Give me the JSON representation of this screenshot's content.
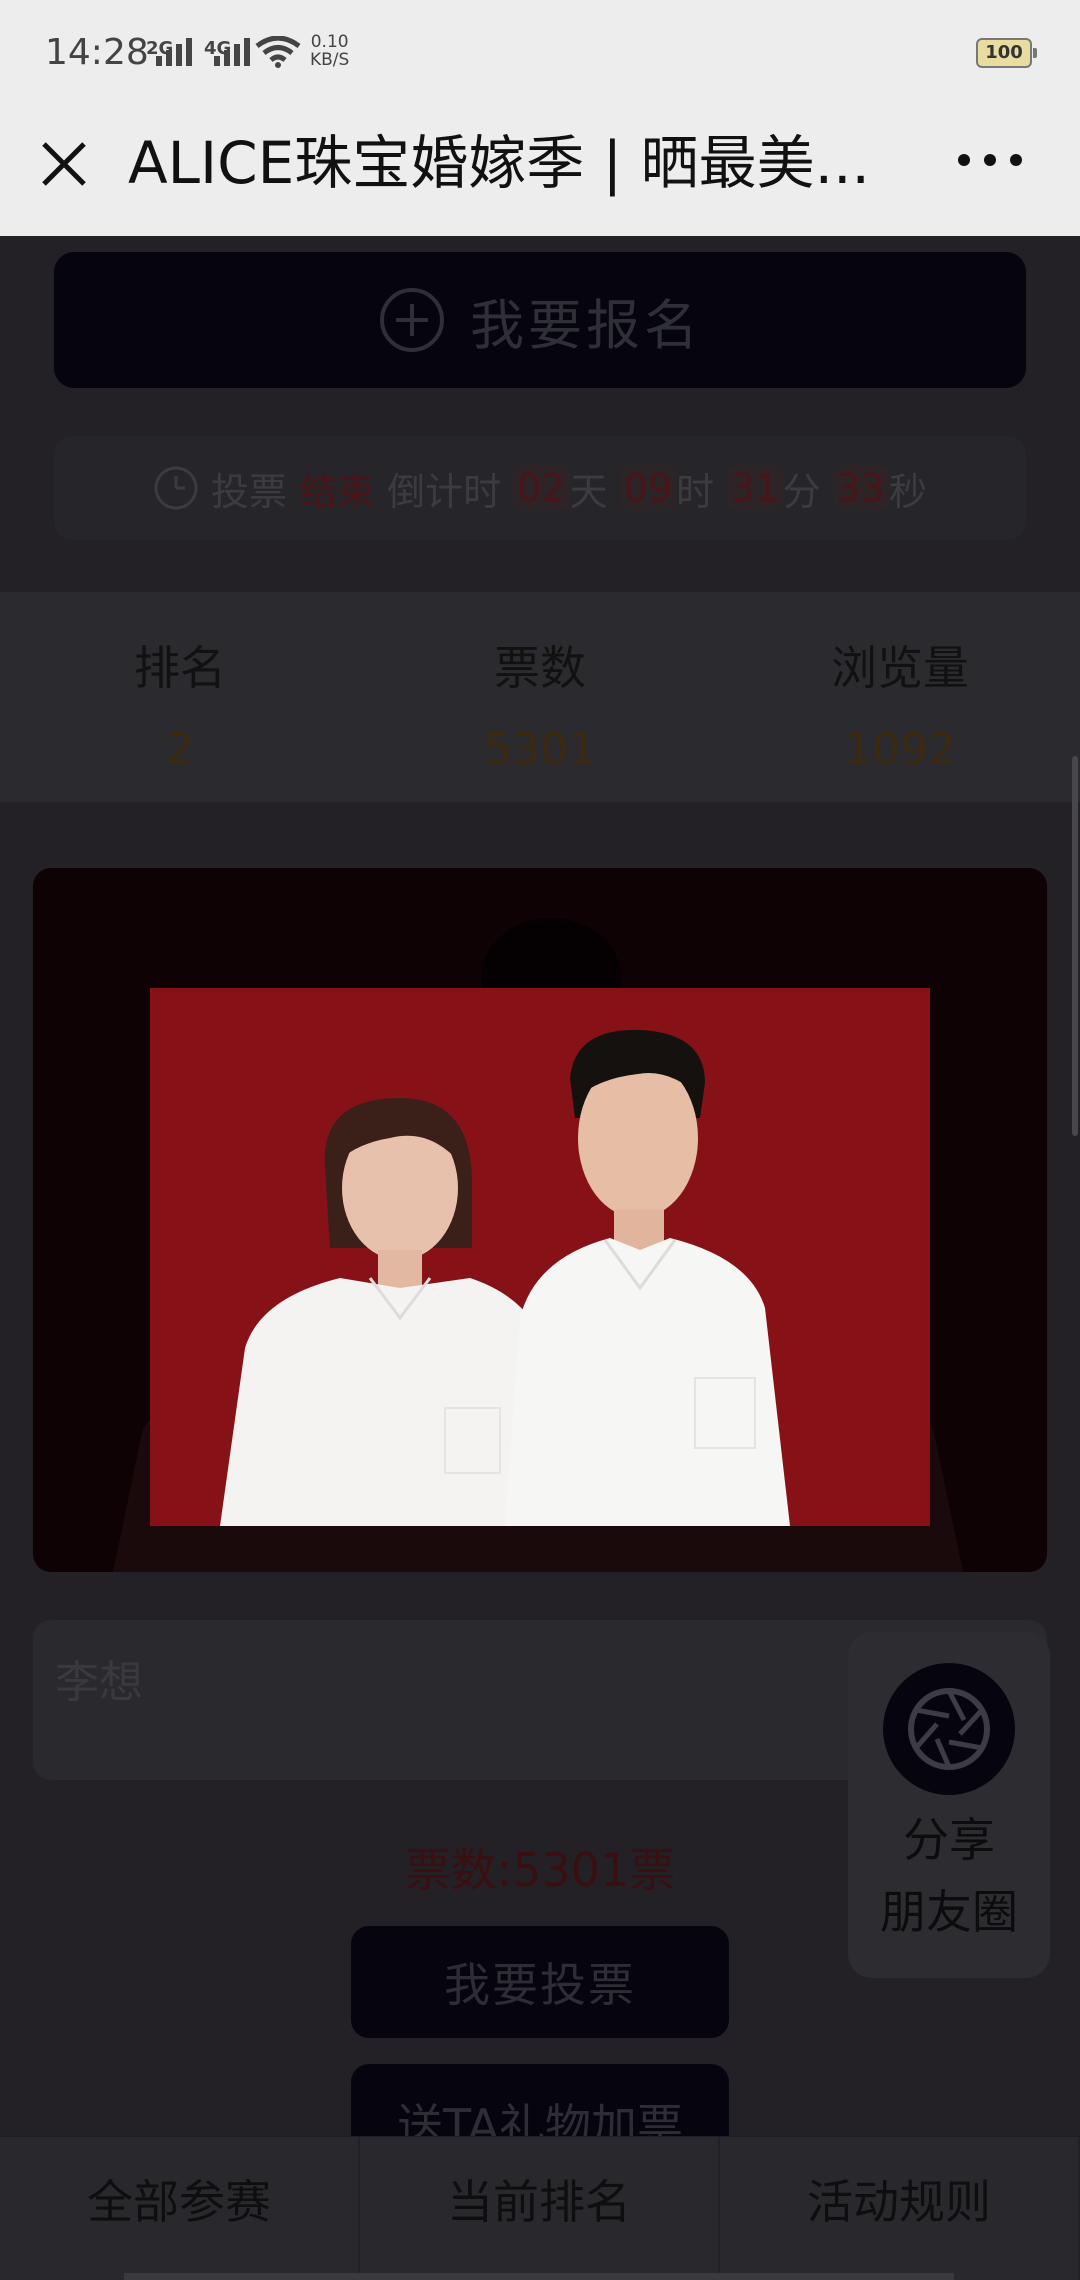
{
  "status_bar": {
    "time": "14:28",
    "sig1": "2G",
    "sig2": "4G",
    "speed_value": "0.10",
    "speed_unit": "KB/S",
    "battery": "100"
  },
  "titlebar": {
    "title": "ALICE珠宝婚嫁季 | 晒最美...",
    "close_icon": "close-icon",
    "more_icon": "more-icon"
  },
  "signup": {
    "label": "我要报名",
    "icon": "plus-circle-icon"
  },
  "countdown": {
    "prefix": "投票",
    "status": "结束",
    "middle": "倒计时",
    "days": "02",
    "days_unit": "天",
    "hours": "09",
    "hours_unit": "时",
    "minutes": "31",
    "minutes_unit": "分",
    "seconds": "33",
    "seconds_unit": "秒"
  },
  "stats": [
    {
      "label": "排名",
      "value": "2"
    },
    {
      "label": "票数",
      "value": "5301"
    },
    {
      "label": "浏览量",
      "value": "1092"
    }
  ],
  "entry": {
    "name": "李想",
    "votes_text": "票数:5301票"
  },
  "share": {
    "line1": "分享",
    "line2": "朋友圈",
    "icon": "camera-aperture-icon"
  },
  "buttons": {
    "vote": "我要投票",
    "gift": "送TA礼物加票"
  },
  "bottom_nav": [
    "全部参赛",
    "当前排名",
    "活动规则"
  ],
  "colors": {
    "photo_bg": "#861218",
    "overlay": "#232126"
  }
}
